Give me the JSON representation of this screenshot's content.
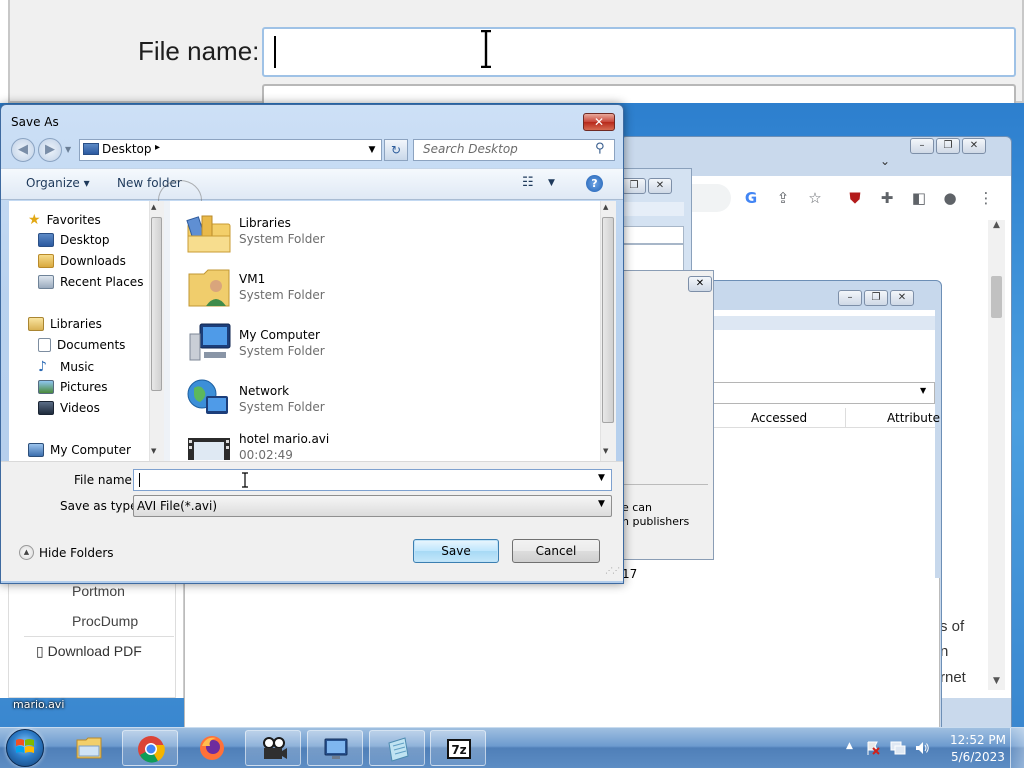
{
  "zoom": {
    "label": "File name:"
  },
  "dialog": {
    "title": "Save As",
    "close_glyph": "✕",
    "address": "Desktop",
    "search_placeholder": "Search Desktop",
    "organize": "Organize ▾",
    "new_folder": "New folder",
    "help": "?"
  },
  "nav_pane": {
    "favorites": "Favorites",
    "desktop": "Desktop",
    "downloads": "Downloads",
    "recent_places": "Recent Places",
    "libraries": "Libraries",
    "documents": "Documents",
    "music": "Music",
    "pictures": "Pictures",
    "videos": "Videos",
    "my_computer": "My Computer"
  },
  "files": [
    {
      "name": "Libraries",
      "type": "System Folder",
      "icon": "libraries-icon"
    },
    {
      "name": "VM1",
      "type": "System Folder",
      "icon": "user-folder-icon"
    },
    {
      "name": "My Computer",
      "type": "System Folder",
      "icon": "computer-icon"
    },
    {
      "name": "Network",
      "type": "System Folder",
      "icon": "network-icon"
    },
    {
      "name": "hotel mario.avi",
      "type": "00:02:49",
      "icon": "video-file-icon"
    }
  ],
  "form": {
    "file_name_label": "File name:",
    "file_name_value": "",
    "save_type_label": "Save as type:",
    "save_type_value": "AVI File(*.avi)",
    "hide_folders": "Hide Folders",
    "save": "Save",
    "cancel": "Cancel"
  },
  "background": {
    "pm_accessed": "Accessed",
    "pm_attributes": "Attribute",
    "sec_text_1": "e can",
    "sec_text_2": "n publishers",
    "date_fragment": "17",
    "web_left_items": [
      "Portmon",
      "ProcDump"
    ],
    "download_pdf": "Download PDF",
    "page_frag_1": "s of",
    "page_frag_2": "n",
    "page_frag_3": "rnet"
  },
  "desktop": {
    "icon_label": "mario.avi"
  },
  "taskbar": {
    "time": "12:52 PM",
    "date": "5/6/2023",
    "apps": [
      "explorer",
      "chrome",
      "firefox",
      "media-encoder",
      "remote-desktop",
      "notepad",
      "7zip"
    ]
  },
  "colors": {
    "dialog_frame": "#b9d2ef",
    "desktop": "#3a87cf",
    "taskbar": "#5d8dc4"
  }
}
